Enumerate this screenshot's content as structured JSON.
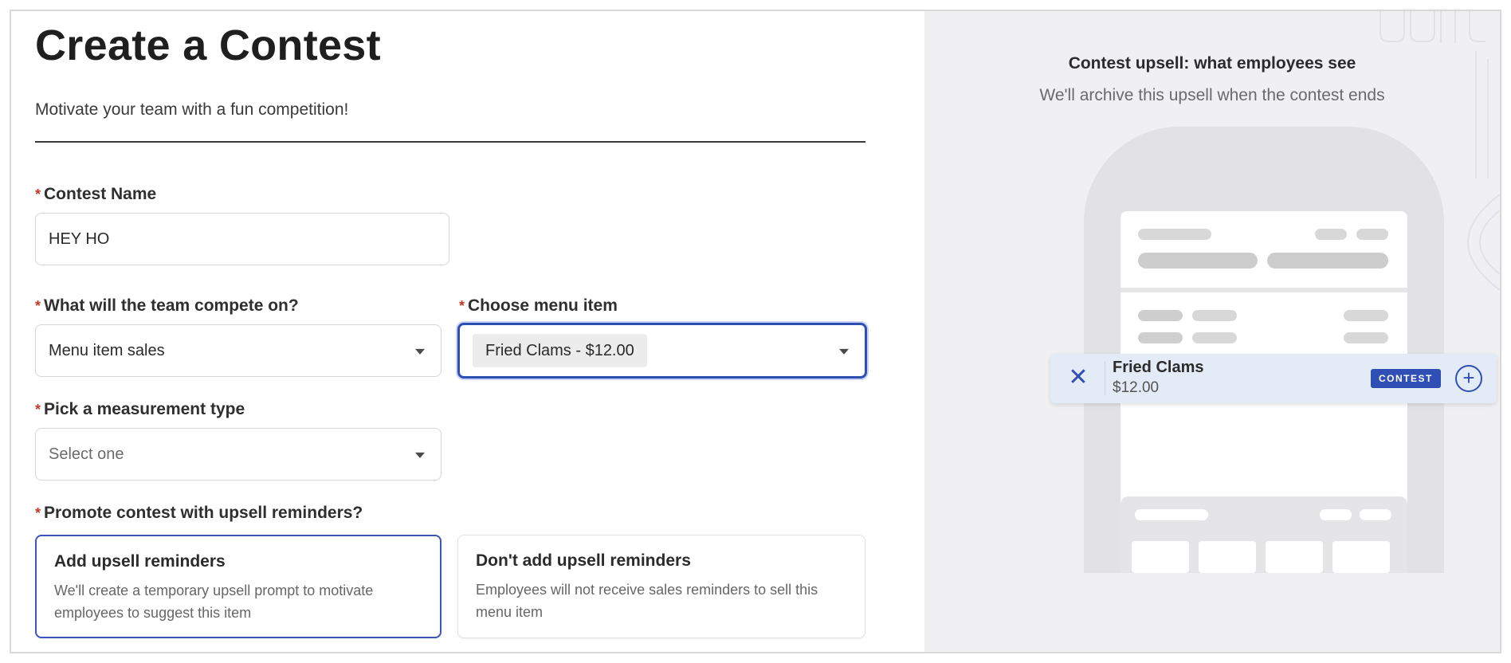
{
  "page": {
    "title": "Create a Contest",
    "subtitle": "Motivate your team with a fun competition!"
  },
  "form": {
    "contest_name": {
      "label": "Contest Name",
      "value": "HEY HO"
    },
    "compete_on": {
      "label": "What will the team compete on?",
      "value": "Menu item sales"
    },
    "menu_item": {
      "label": "Choose menu item",
      "value": "Fried Clams - $12.00"
    },
    "measurement": {
      "label": "Pick a measurement type",
      "placeholder": "Select one"
    },
    "upsell": {
      "label": "Promote contest with upsell reminders?",
      "options": [
        {
          "title": "Add upsell reminders",
          "description": "We'll create a temporary upsell prompt to motivate employees to suggest this item",
          "selected": true
        },
        {
          "title": "Don't add upsell reminders",
          "description": "Employees will not receive sales reminders to sell this menu item",
          "selected": false
        }
      ]
    },
    "required_marker": "*"
  },
  "preview": {
    "title": "Contest upsell: what employees see",
    "subtitle": "We'll archive this upsell when the contest ends",
    "upsell_card": {
      "item_name": "Fried Clams",
      "item_price": "$12.00",
      "badge": "CONTEST",
      "close_icon": "close-icon",
      "add_icon": "plus-circle-icon"
    }
  },
  "colors": {
    "accent": "#2f4fb4",
    "required": "#c0392b",
    "preview_bg": "#f0f0f2",
    "upsell_bg": "#e3ebf7"
  }
}
